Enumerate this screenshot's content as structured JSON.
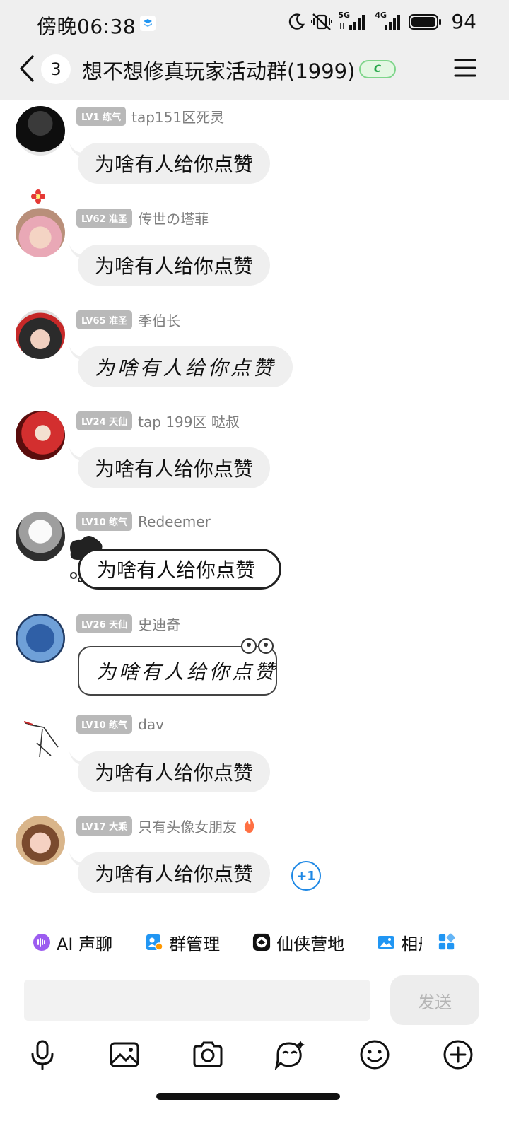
{
  "status_bar": {
    "time": "傍晚06:38",
    "battery": "94",
    "net1": "5G",
    "net2": "4G"
  },
  "header": {
    "unread": "3",
    "title": "想不想修真玩家活动群(1999)"
  },
  "messages": [
    {
      "level": "LV1 练气",
      "name": "tap151区死灵",
      "text": "为啥有人给你点赞",
      "style": "plain"
    },
    {
      "level": "LV62 准圣",
      "name": "传世の塔菲",
      "text": "为啥有人给你点赞",
      "style": "plain"
    },
    {
      "level": "LV65 准圣",
      "name": "季伯长",
      "text": "为啥有人给你点赞",
      "style": "hand"
    },
    {
      "level": "LV24 天仙",
      "name": "tap 199区 哒叔",
      "text": "为啥有人给你点赞",
      "style": "plain"
    },
    {
      "level": "LV10 练气",
      "name": "Redeemer",
      "text": "为啥有人给你点赞",
      "style": "outline"
    },
    {
      "level": "LV26 天仙",
      "name": "史迪奇",
      "text": "为啥有人给你点赞",
      "style": "box"
    },
    {
      "level": "LV10 练气",
      "name": "dav",
      "text": "为啥有人给你点赞",
      "style": "plain"
    },
    {
      "level": "LV17 大乘",
      "name": "只有头像女朋友",
      "text": "为啥有人给你点赞",
      "style": "plain",
      "plus": "+1"
    }
  ],
  "quick_bar": [
    {
      "label": "AI 声聊",
      "icon": "ai-voice-icon"
    },
    {
      "label": "群管理",
      "icon": "group-manage-icon"
    },
    {
      "label": "仙侠营地",
      "icon": "camp-icon"
    },
    {
      "label": "相册",
      "icon": "album-icon"
    }
  ],
  "composer": {
    "placeholder": "",
    "send": "发送"
  },
  "toolbar_icons": [
    "mic-icon",
    "image-icon",
    "camera-icon",
    "sticker-icon",
    "emoji-icon",
    "plus-icon"
  ],
  "colors": {
    "accent": "#1e88e5",
    "level_badge": "#b9b9b9",
    "bubble": "#efefef",
    "header_bg": "#efefef"
  }
}
